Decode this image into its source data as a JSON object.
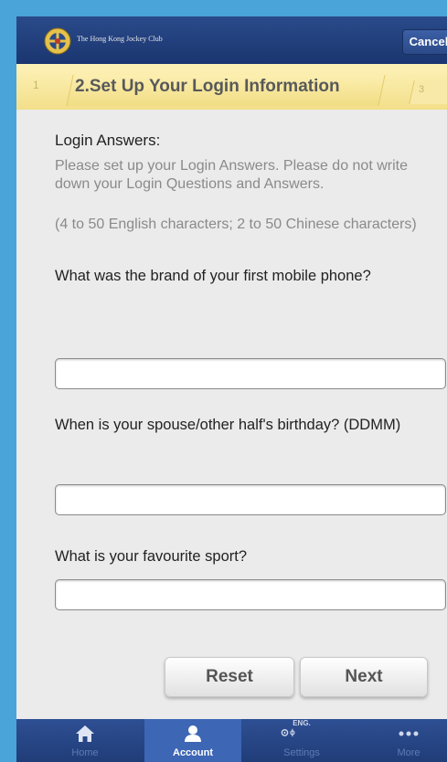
{
  "header": {
    "brand": "The Hong Kong Jockey Club",
    "cancel_label": "Cancel"
  },
  "steps": {
    "prev": "1",
    "current": "2.Set Up Your Login Information",
    "next": "3"
  },
  "form": {
    "section_title": "Login Answers:",
    "description": "Please set up your Login Answers. Please do not write down your Login Questions and Answers.",
    "char_rule": "(4 to 50 English characters; 2 to 50 Chinese characters)",
    "questions": [
      {
        "label": "What was the brand of your first mobile phone?",
        "value": "",
        "placeholder": ""
      },
      {
        "label": "When is your spouse/other half's birthday? (DDMM)",
        "value": "",
        "placeholder": ""
      },
      {
        "label": "What is your favourite sport?",
        "value": "",
        "placeholder": ""
      }
    ],
    "reset_label": "Reset",
    "next_label": "Next"
  },
  "tabbar": {
    "items": [
      {
        "label": "Home",
        "icon": "home-icon"
      },
      {
        "label": "Account",
        "icon": "account-icon",
        "active": true
      },
      {
        "label": "Settings",
        "icon": "settings-icon",
        "badge": "ENG."
      },
      {
        "label": "More",
        "icon": "more-icon"
      }
    ]
  },
  "colors": {
    "header": "#1b3670",
    "step_bar": "#f3df8a",
    "page_bg": "#ebebeb",
    "outer_bg": "#4aa3d9",
    "active_tab": "#3d66b4"
  }
}
